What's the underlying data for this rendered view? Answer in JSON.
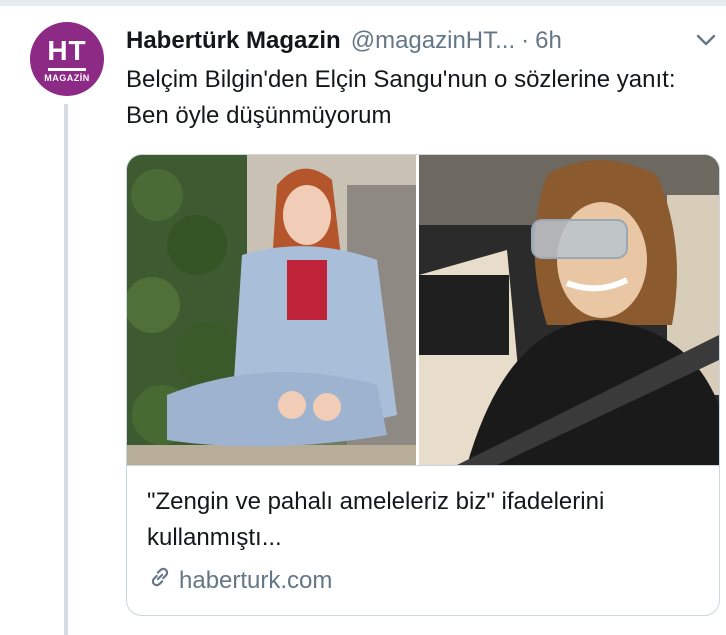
{
  "tweet": {
    "author_name": "Habertürk Magazin",
    "author_handle": "@magazinHT...",
    "separator": "·",
    "time": "6h",
    "text": "Belçim Bilgin'den Elçin Sangu'nun o sözlerine yanıt: Ben öyle düşünmüyorum",
    "avatar": {
      "line1": "HT",
      "line2": "MAGAZİN",
      "color": "#8c2a86"
    }
  },
  "card": {
    "description": "\"Zengin ve pahalı ameleleriz biz\" ifadelerini kullanmıştı...",
    "domain": "haberturk.com",
    "images": [
      {
        "icon": "woman-sitting-photo"
      },
      {
        "icon": "woman-in-car-photo"
      }
    ]
  },
  "colors": {
    "text": "#14171a",
    "muted": "#657786",
    "border": "#ccd6dd",
    "thread": "#d6dce1"
  }
}
